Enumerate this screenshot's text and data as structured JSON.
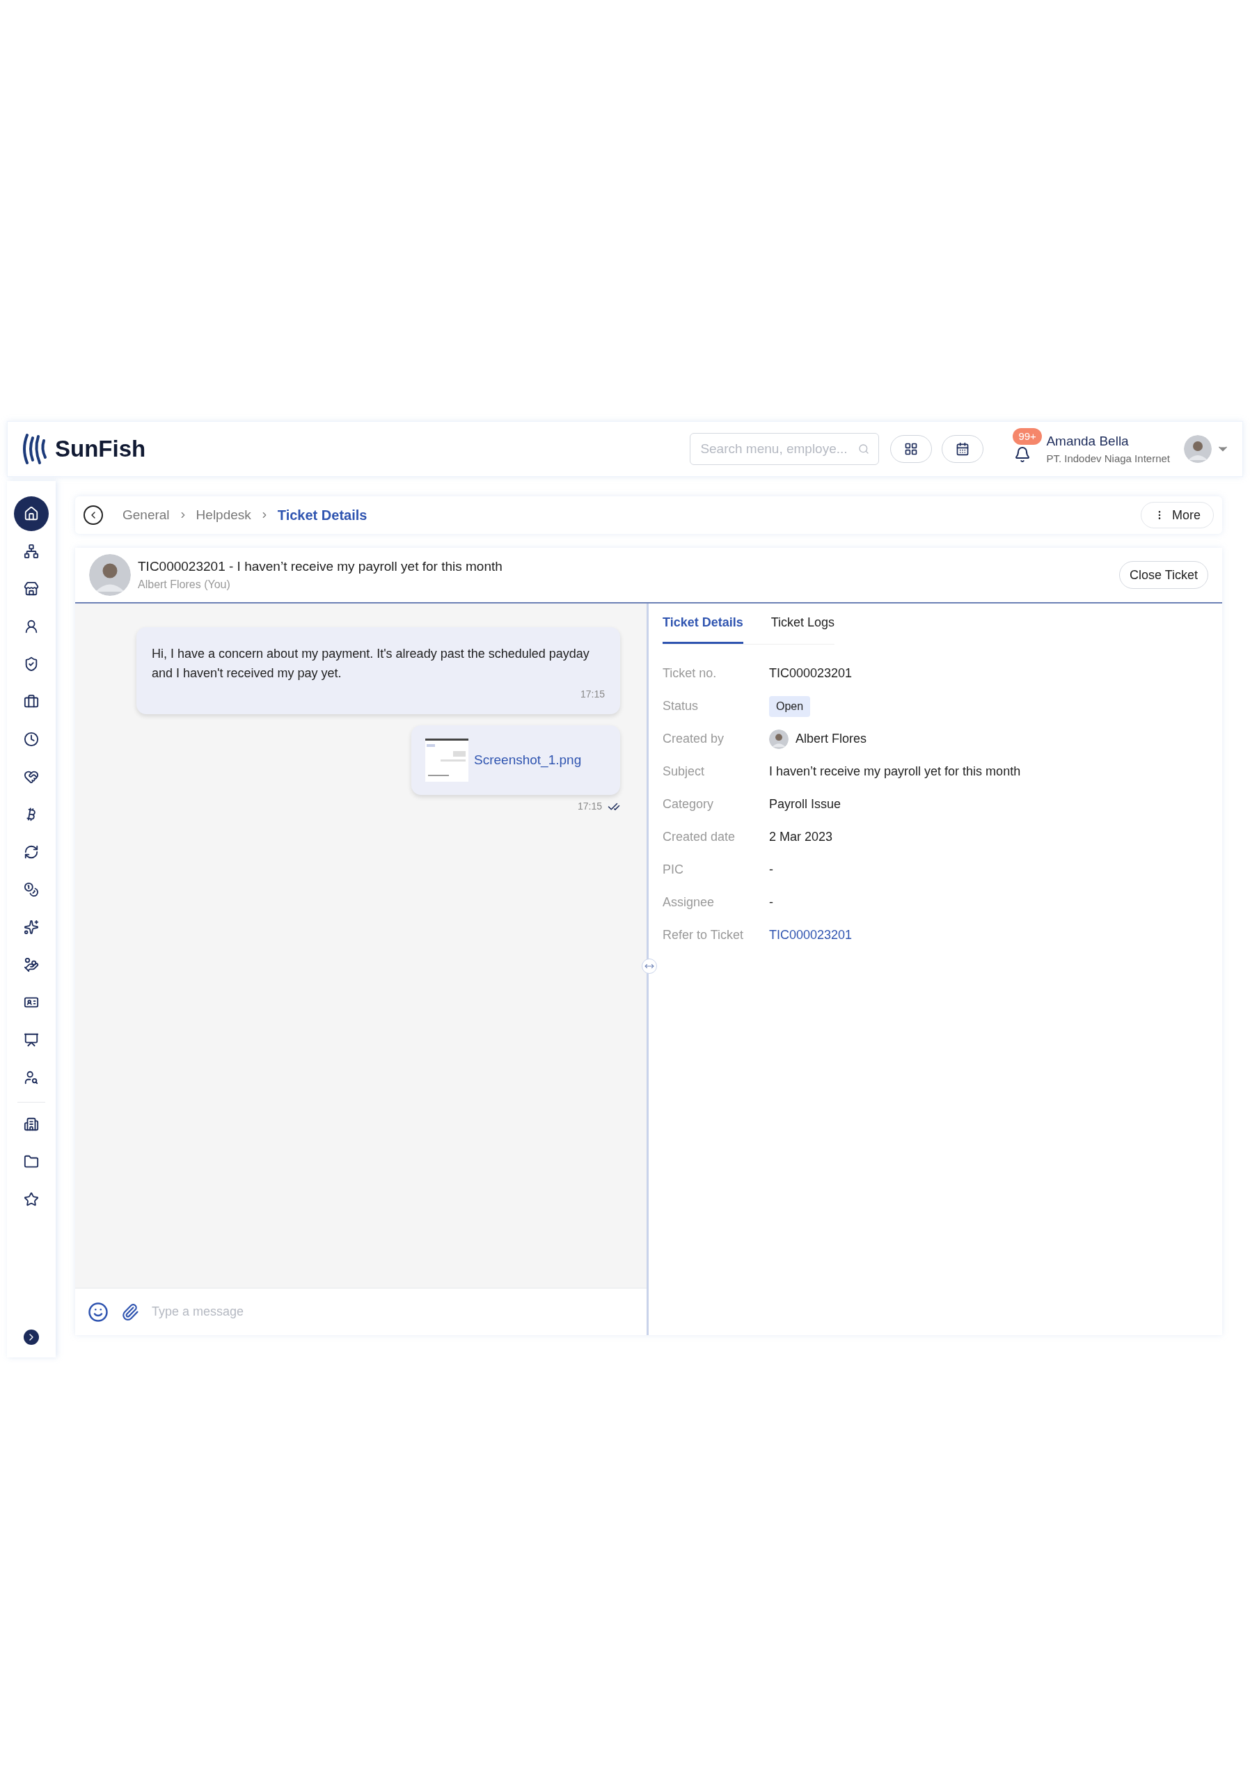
{
  "header": {
    "logo": "SunFish",
    "search": {
      "placeholder": "Search menu, employe..."
    },
    "notifications": {
      "badge": "99+"
    },
    "user": {
      "name": "Amanda Bella",
      "company": "PT. Indodev Niaga Internet"
    }
  },
  "sidebar": {
    "items": [
      {
        "selected": true
      },
      {
        "selected": false
      },
      {
        "selected": false
      },
      {
        "selected": false
      },
      {
        "selected": false
      },
      {
        "selected": false
      },
      {
        "selected": false
      },
      {
        "selected": false
      },
      {
        "selected": false
      },
      {
        "selected": false
      },
      {
        "selected": false
      },
      {
        "selected": false
      },
      {
        "selected": false
      },
      {
        "selected": false
      },
      {
        "selected": false
      },
      {
        "selected": false
      },
      {
        "selected": false
      },
      {
        "selected": false
      },
      {
        "selected": false
      }
    ]
  },
  "breadcrumb": [
    "General",
    "Helpdesk",
    "Ticket Details"
  ],
  "more_button": "More",
  "ticket": {
    "title": "TIC000023201 - I haven’t receive my payroll yet for this month",
    "author": "Albert Flores (You)",
    "close_button": "Close Ticket"
  },
  "messages": [
    {
      "kind": "text",
      "text": "Hi, I have a concern about my payment. It's already past the scheduled payday and I haven't received my pay yet.",
      "time": "17:15",
      "read": false
    },
    {
      "kind": "file",
      "file_name": "Screenshot_1.png",
      "time": "17:15",
      "read": true
    }
  ],
  "composer": {
    "placeholder": "Type a message"
  },
  "tabs": [
    {
      "label": "Ticket Details",
      "selected": true
    },
    {
      "label": "Ticket Logs",
      "selected": false
    }
  ],
  "details": [
    {
      "label": "Ticket no.",
      "value": "TIC000023201",
      "kind": "text"
    },
    {
      "label": "Status",
      "value": "Open",
      "kind": "badge"
    },
    {
      "label": "Created by",
      "value": "Albert Flores",
      "kind": "person"
    },
    {
      "label": "Subject",
      "value": "I haven’t receive my payroll yet for this month",
      "kind": "text"
    },
    {
      "label": "Category",
      "value": "Payroll Issue",
      "kind": "text"
    },
    {
      "label": "Created date",
      "value": "2 Mar 2023",
      "kind": "text"
    },
    {
      "label": "PIC",
      "value": "-",
      "kind": "text"
    },
    {
      "label": "Assignee",
      "value": "-",
      "kind": "text"
    },
    {
      "label": "Refer to Ticket",
      "value": "TIC000023201",
      "kind": "link"
    }
  ]
}
